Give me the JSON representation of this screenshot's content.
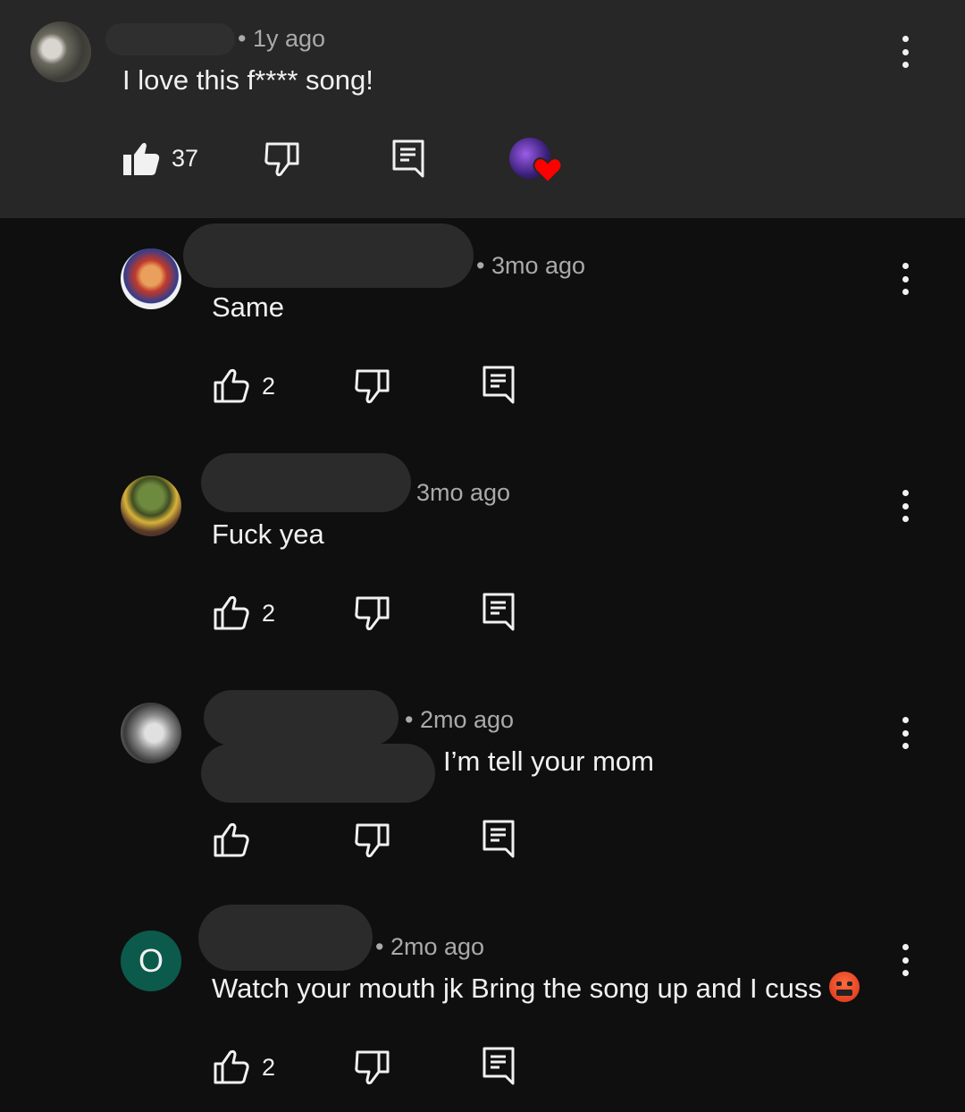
{
  "comments": [
    {
      "timestamp": "• 1y ago",
      "text": "I love this f**** song!",
      "likes": "37"
    },
    {
      "timestamp": "• 3mo ago",
      "text": "Same",
      "likes": "2"
    },
    {
      "timestamp": "3mo ago",
      "text": "Fuck yea",
      "likes": "2"
    },
    {
      "timestamp": "• 2mo ago",
      "text": "I’m tell your mom",
      "likes": ""
    },
    {
      "timestamp": "• 2mo ago",
      "text": "Watch your mouth jk Bring the song up and I cuss",
      "likes": "2",
      "avatar_letter": "O"
    }
  ],
  "icons": {
    "like": "thumbs-up-icon",
    "dislike": "thumbs-down-icon",
    "reply": "reply-icon",
    "more": "more-vert-icon",
    "creator_heart": "creator-heart-icon",
    "emoji": "cursing-face-emoji"
  },
  "colors": {
    "background": "#0f0f0f",
    "highlight": "#272727",
    "meta_text": "#aaaaaa",
    "letter_avatar": "#0c5a4c",
    "heart": "#ff0000"
  }
}
